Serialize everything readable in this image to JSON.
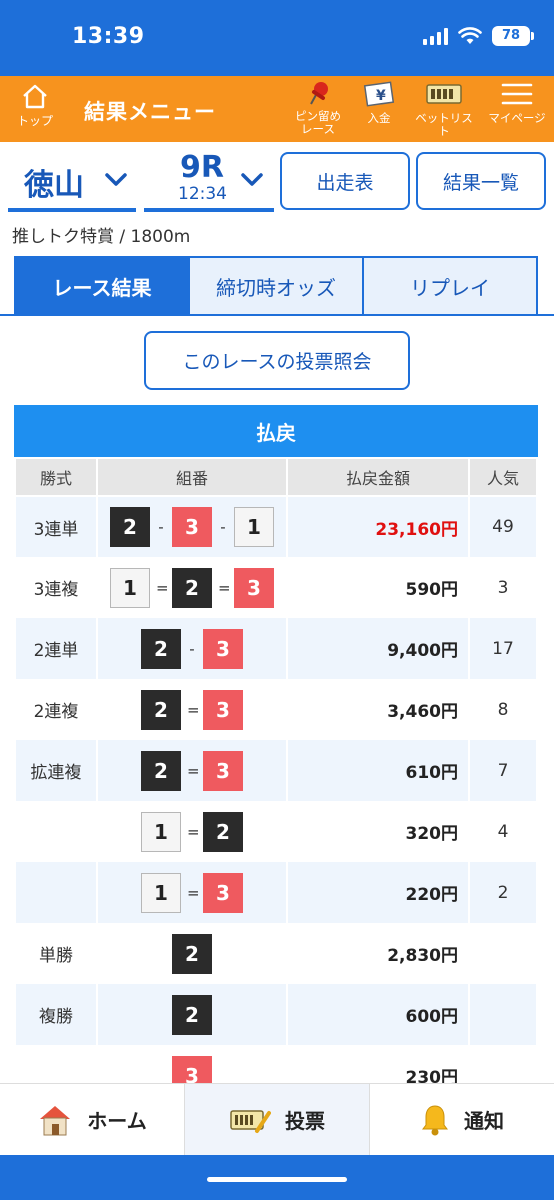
{
  "status": {
    "time": "13:39",
    "battery": "78"
  },
  "menubar": {
    "home_label": "トップ",
    "title": "結果メニュー",
    "pin_label_1": "ピン留め",
    "pin_label_2": "レース",
    "deposit_label": "入金",
    "betlist_label": "ベットリスト",
    "mypage_label": "マイページ"
  },
  "selector": {
    "venue": "徳山",
    "race": "9R",
    "race_time": "12:34",
    "entries_button": "出走表",
    "results_button": "結果一覧"
  },
  "race_info": "推しトク特賞 / 1800m",
  "tabs": [
    {
      "label": "レース結果",
      "active": true
    },
    {
      "label": "締切時オッズ",
      "active": false
    },
    {
      "label": "リプレイ",
      "active": false
    }
  ],
  "vote_inquiry_button": "このレースの投票照会",
  "payout": {
    "header": "払戻",
    "columns": [
      "勝式",
      "組番",
      "払戻金額",
      "人気"
    ],
    "rows": [
      {
        "kind": "3連単",
        "boats": [
          "2",
          "3",
          "1"
        ],
        "sep": "-",
        "amount": "23,160円",
        "popularity": "49",
        "highlight": true
      },
      {
        "kind": "3連複",
        "boats": [
          "1",
          "2",
          "3"
        ],
        "sep": "=",
        "amount": "590円",
        "popularity": "3"
      },
      {
        "kind": "2連単",
        "boats": [
          "2",
          "3"
        ],
        "sep": "-",
        "amount": "9,400円",
        "popularity": "17"
      },
      {
        "kind": "2連複",
        "boats": [
          "2",
          "3"
        ],
        "sep": "=",
        "amount": "3,460円",
        "popularity": "8"
      },
      {
        "kind": "拡連複",
        "boats": [
          "2",
          "3"
        ],
        "sep": "=",
        "amount": "610円",
        "popularity": "7"
      },
      {
        "kind": "",
        "boats": [
          "1",
          "2"
        ],
        "sep": "=",
        "amount": "320円",
        "popularity": "4"
      },
      {
        "kind": "",
        "boats": [
          "1",
          "3"
        ],
        "sep": "=",
        "amount": "220円",
        "popularity": "2"
      },
      {
        "kind": "単勝",
        "boats": [
          "2"
        ],
        "sep": "",
        "amount": "2,830円",
        "popularity": ""
      },
      {
        "kind": "複勝",
        "boats": [
          "2"
        ],
        "sep": "",
        "amount": "600円",
        "popularity": ""
      },
      {
        "kind": "",
        "boats": [
          "3"
        ],
        "sep": "",
        "amount": "230円",
        "popularity": ""
      }
    ]
  },
  "bottomnav": {
    "home": "ホーム",
    "vote": "投票",
    "notify": "通知"
  },
  "colors": {
    "primary": "#1e6fd9",
    "menu_orange": "#f7931e",
    "boat2": "#2b2b2b",
    "boat3": "#ef5a5f",
    "highlight_red": "#e01010"
  }
}
